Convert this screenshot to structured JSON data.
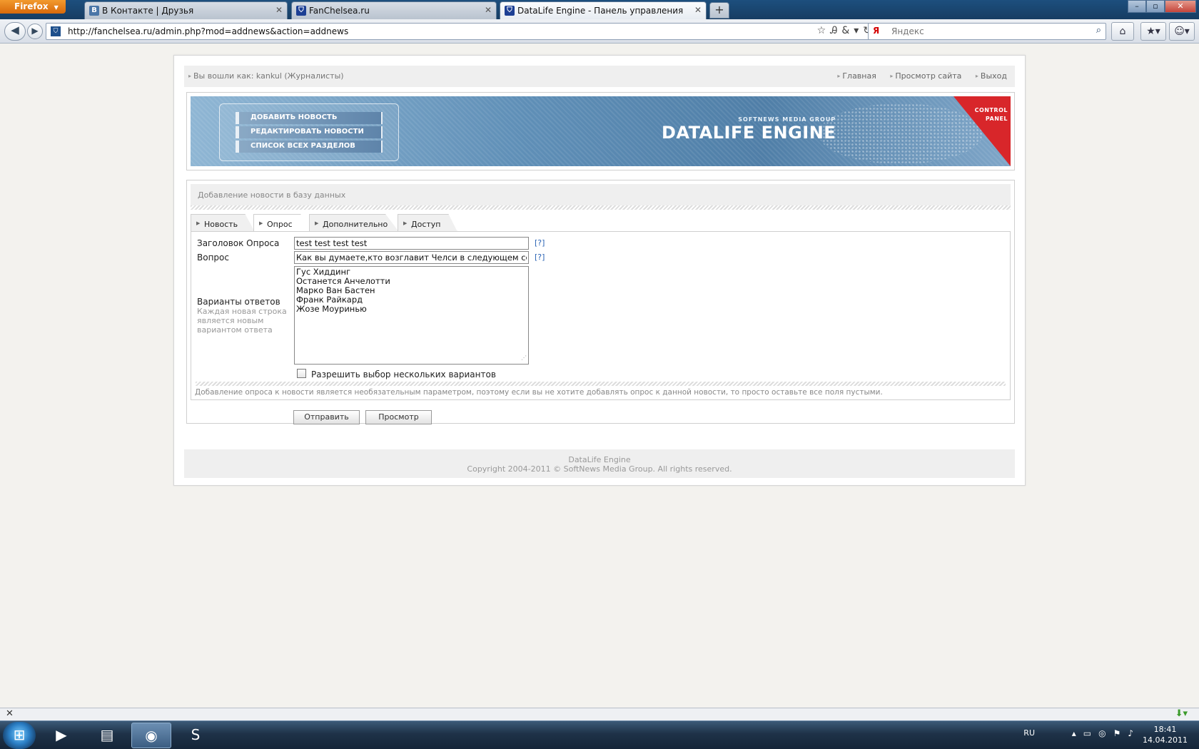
{
  "browser": {
    "menu_label": "Firefox",
    "tabs": [
      {
        "title": "В Контакте | Друзья",
        "icon": "vk-icon",
        "color": "#4a76a8"
      },
      {
        "title": "FanChelsea.ru",
        "icon": "chelsea-icon",
        "color": "#1c3f94"
      },
      {
        "title": "DataLife Engine - Панель управления",
        "icon": "chelsea-icon",
        "color": "#1c3f94"
      }
    ],
    "url": "http://fanchelsea.ru/admin.php?mod=addnews&action=addnews",
    "search_placeholder": "Яндекс",
    "search_engine_glyph": "Я"
  },
  "userbar": {
    "logged_in": "Вы вошли как: kankul (Журналисты)",
    "links": [
      "Главная",
      "Просмотр сайта",
      "Выход"
    ]
  },
  "banner": {
    "menu": [
      "ДОБАВИТЬ НОВОСТЬ",
      "РЕДАКТИРОВАТЬ НОВОСТИ",
      "СПИСОК ВСЕХ РАЗДЕЛОВ"
    ],
    "brand_sub": "SOFTNEWS MEDIA GROUP",
    "brand_main": "DATALIFE ENGINE",
    "corner_line1": "CONTROL",
    "corner_line2": "PANEL"
  },
  "form": {
    "title": "Добавление новости в базу данных",
    "tabs": [
      "Новость",
      "Опрос",
      "Дополнительно",
      "Доступ"
    ],
    "active_tab": "Опрос",
    "poll_title_label": "Заголовок Опроса",
    "poll_title_value": "test test test test",
    "question_label": "Вопрос",
    "question_value": "Как вы думаете,кто возглавит Челси в следующем сезоне?",
    "help_text": "[?]",
    "answers_label": "Варианты ответов",
    "answers_hint": "Каждая новая строка является новым вариантом ответа",
    "answers": [
      "Гус Хиддинг",
      "Останется Анчелотти",
      "Марко Ван Бастен",
      "Франк Райкард",
      "Жозе Моуринью"
    ],
    "multi_label": "Разрешить выбор нескольких вариантов",
    "multi_checked": false,
    "note": "Добавление опроса к новости является необязательным параметром, поэтому если вы не хотите добавлять опрос к данной новости, то просто оставьте все поля пустыми.",
    "submit_label": "Отправить",
    "preview_label": "Просмотр"
  },
  "footer": {
    "line1": "DataLife Engine",
    "line2": "Copyright 2004-2011 © SoftNews Media Group. All rights reserved."
  },
  "taskbar": {
    "lang": "RU",
    "time": "18:41",
    "date": "14.04.2011"
  }
}
